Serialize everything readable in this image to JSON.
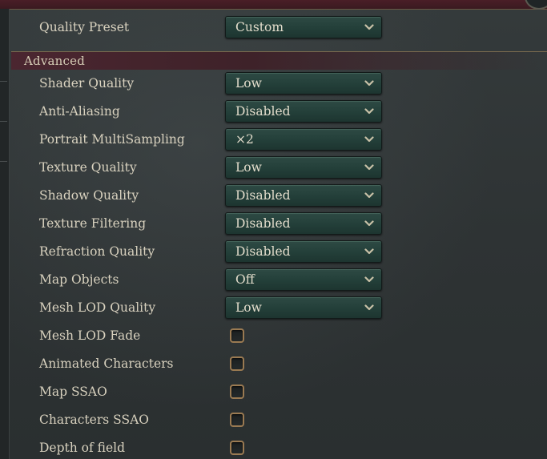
{
  "quality_preset": {
    "label": "Quality Preset",
    "value": "Custom"
  },
  "advanced": {
    "header": "Advanced",
    "dropdowns": [
      {
        "label": "Shader Quality",
        "value": "Low"
      },
      {
        "label": "Anti-Aliasing",
        "value": "Disabled"
      },
      {
        "label": "Portrait MultiSampling",
        "value": "×2"
      },
      {
        "label": "Texture Quality",
        "value": "Low"
      },
      {
        "label": "Shadow Quality",
        "value": "Disabled"
      },
      {
        "label": "Texture Filtering",
        "value": "Disabled"
      },
      {
        "label": "Refraction Quality",
        "value": "Disabled"
      },
      {
        "label": "Map Objects",
        "value": "Off"
      },
      {
        "label": "Mesh LOD Quality",
        "value": "Low"
      }
    ],
    "checkboxes": [
      {
        "label": "Mesh LOD Fade",
        "checked": false
      },
      {
        "label": "Animated Characters",
        "checked": false
      },
      {
        "label": "Map SSAO",
        "checked": false
      },
      {
        "label": "Characters SSAO",
        "checked": false
      },
      {
        "label": "Depth of field",
        "checked": false
      }
    ]
  },
  "icons": {
    "dropdown_arrow": "chevron-down-icon",
    "checkbox": "checkbox-empty"
  },
  "colors": {
    "dropdown_bg": "#24403a",
    "header_bg": "#4b2630",
    "checkbox_border": "#9a7a52",
    "text": "#d9d2bf"
  }
}
